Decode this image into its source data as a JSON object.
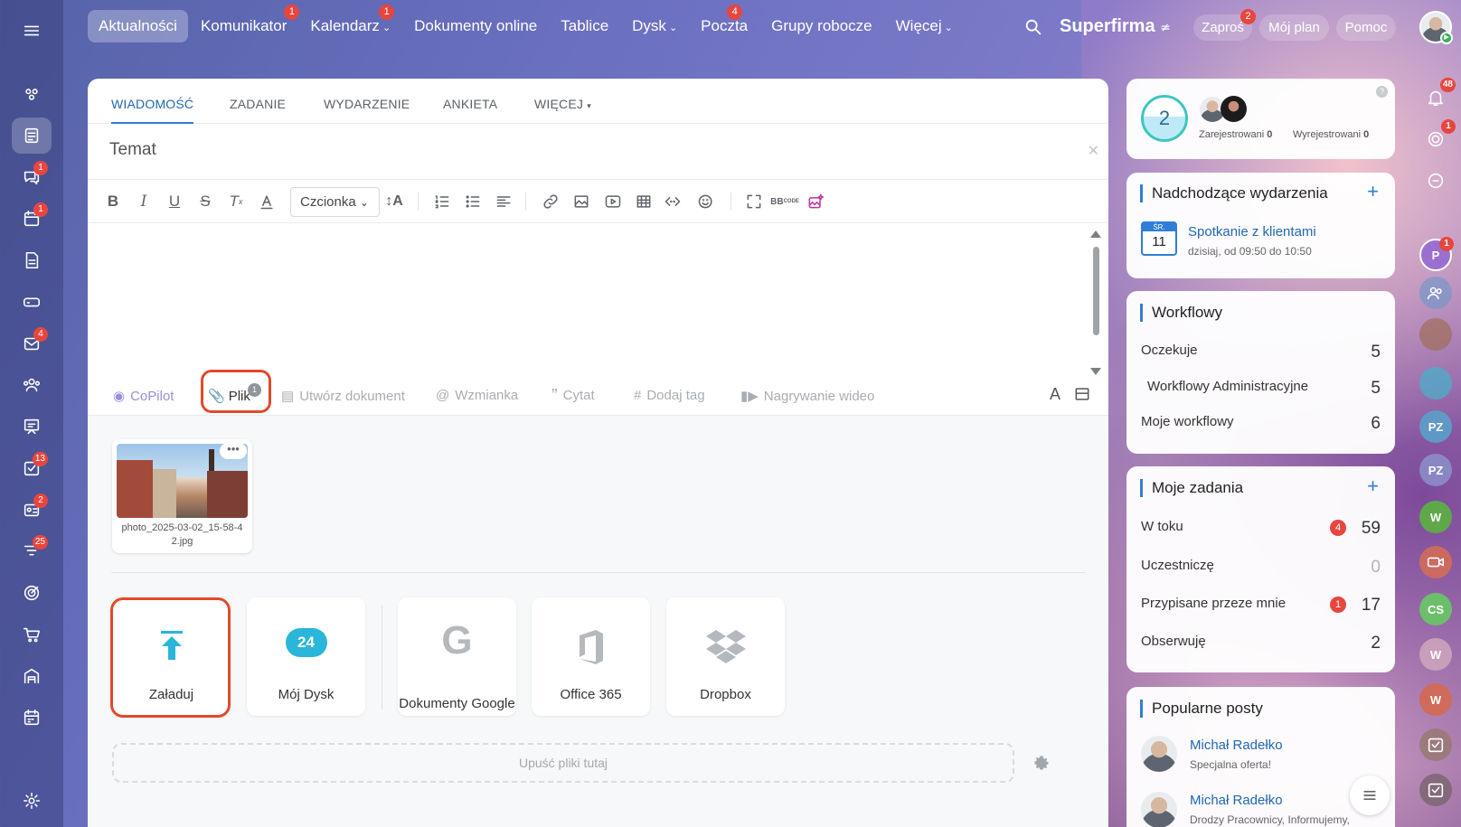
{
  "topnav": {
    "items": [
      {
        "label": "Aktualności",
        "badge": ""
      },
      {
        "label": "Komunikator",
        "badge": "1"
      },
      {
        "label": "Kalendarz",
        "badge": "1"
      },
      {
        "label": "Dokumenty online",
        "badge": ""
      },
      {
        "label": "Tablice",
        "badge": ""
      },
      {
        "label": "Dysk",
        "badge": ""
      },
      {
        "label": "Poczta",
        "badge": "4"
      },
      {
        "label": "Grupy robocze",
        "badge": ""
      },
      {
        "label": "Więcej",
        "badge": ""
      }
    ],
    "brand": "Superfirma",
    "invite_label": "Zaproś",
    "invite_badge": "2",
    "plan_label": "Mój plan",
    "help_label": "Pomoc"
  },
  "leftrail": {
    "badges": {
      "chat": "1",
      "calendar": "1",
      "mail": "4",
      "tasks": "13",
      "crm": "2",
      "funnel": "25"
    }
  },
  "composer": {
    "tabs": [
      "WIADOMOŚĆ",
      "ZADANIE",
      "WYDARZENIE",
      "ANKIETA",
      "WIĘCEJ"
    ],
    "subject_placeholder": "Temat",
    "font_label": "Czcionka",
    "actions": {
      "copilot": "CoPilot",
      "file": "Plik",
      "file_count": "1",
      "create_doc": "Utwórz dokument",
      "mention": "Wzmianka",
      "quote": "Cytat",
      "tag": "Dodaj tag",
      "video": "Nagrywanie wideo"
    },
    "file_name": "photo_2025-03-02_15-58-42.jpg",
    "sources": [
      {
        "label": "Załaduj"
      },
      {
        "label": "Mój Dysk"
      },
      {
        "label": "Dokumenty Google"
      },
      {
        "label": "Office 365"
      },
      {
        "label": "Dropbox"
      }
    ],
    "drive_icon_text": "24",
    "drop_label": "Upuść pliki tutaj"
  },
  "widgets": {
    "presence": {
      "count": "2",
      "registered_label": "Zarejestrowani",
      "registered_value": "0",
      "unregistered_label": "Wyrejestrowani",
      "unregistered_value": "0"
    },
    "events": {
      "title": "Nadchodzące wydarzenia",
      "day_abbr": "ŚR.",
      "day": "11",
      "event_title": "Spotkanie z klientami",
      "event_time": "dzisiaj, od 09:50 do 10:50"
    },
    "workflows": {
      "title": "Workflowy",
      "rows": [
        {
          "label": "Oczekuje",
          "value": "5"
        },
        {
          "label": "Workflowy Administracyjne",
          "value": "5"
        },
        {
          "label": "Moje workflowy",
          "value": "6"
        }
      ]
    },
    "tasks": {
      "title": "Moje zadania",
      "rows": [
        {
          "label": "W toku",
          "badge": "4",
          "value": "59"
        },
        {
          "label": "Uczestniczę",
          "badge": "",
          "value": "0"
        },
        {
          "label": "Przypisane przeze mnie",
          "badge": "1",
          "value": "17"
        },
        {
          "label": "Obserwuję",
          "badge": "",
          "value": "2"
        }
      ]
    },
    "posts": {
      "title": "Popularne posty",
      "items": [
        {
          "author": "Michał Radełko",
          "text": "Specjalna oferta!"
        },
        {
          "author": "Michał Radełko",
          "text": "Drodzy Pracownicy, Informujemy,"
        }
      ]
    }
  },
  "rightrail": {
    "notif_badge": "48",
    "pulse_badge": "1",
    "p_badge": "1",
    "initials": [
      "P",
      "PZ",
      "PZ",
      "W",
      "CS",
      "W",
      "W"
    ]
  },
  "colors": {
    "accent": "#2f7ed8",
    "highlight": "#e04a2a",
    "badge": "#e7463f"
  }
}
